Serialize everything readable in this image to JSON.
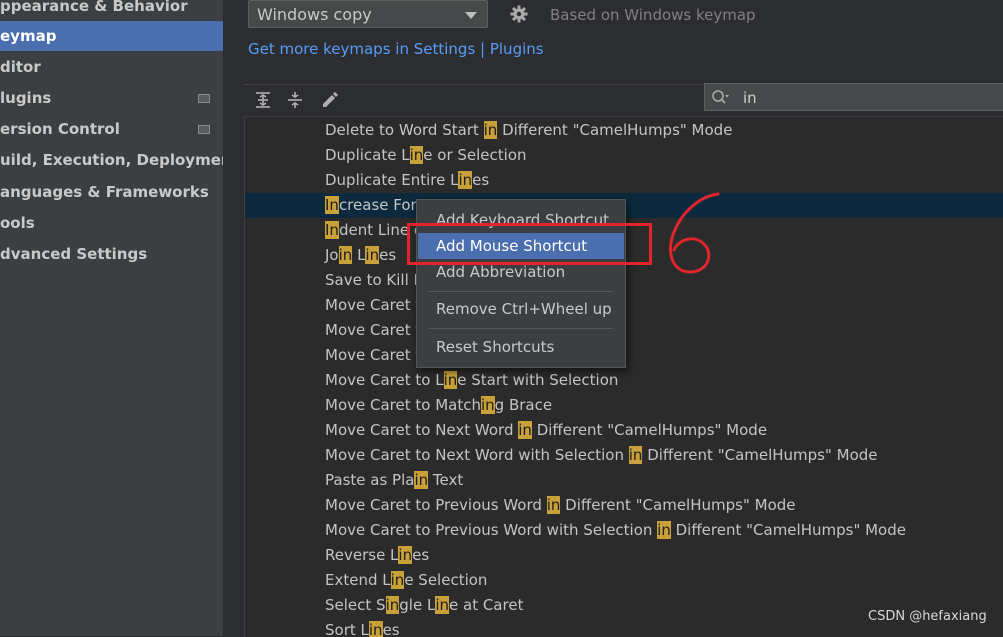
{
  "sidebar": {
    "items": [
      {
        "label": "ppearance & Behavior"
      },
      {
        "label": "eymap"
      },
      {
        "label": "ditor"
      },
      {
        "label": "lugins"
      },
      {
        "label": "ersion Control"
      },
      {
        "label": "uild, Execution, Deployment"
      },
      {
        "label": "anguages & Frameworks"
      },
      {
        "label": "ools"
      },
      {
        "label": "dvanced Settings"
      }
    ]
  },
  "header": {
    "keymap_selected": "Windows copy",
    "based_on": "Based on Windows keymap",
    "more_keymaps_link": "Get more keymaps in Settings | Plugins"
  },
  "search": {
    "value": "in"
  },
  "actions": [
    {
      "pre": "Delete to Word Start ",
      "hl": "in",
      "post": " Different \"CamelHumps\" Mode"
    },
    {
      "pre": "Duplicate L",
      "hl": "in",
      "post": "e or Selection"
    },
    {
      "pre": "Duplicate Entire L",
      "hl": "in",
      "post": "es"
    },
    {
      "pre": "",
      "hl": "In",
      "post": "crease Font"
    },
    {
      "pre": "",
      "hl": "In",
      "post": "dent Line o"
    },
    {
      "pre": "Jo",
      "hl": "in",
      "post": " L",
      "hl2": "in",
      "post2": "es"
    },
    {
      "pre": "Save to Kill R",
      "hl": "",
      "post": ""
    },
    {
      "pre": "Move Caret t",
      "hl": "",
      "post": ""
    },
    {
      "pre": "Move Caret t",
      "hl": "",
      "post": ""
    },
    {
      "pre": "Move Caret t",
      "hl": "",
      "post": ""
    },
    {
      "pre": "Move Caret to L",
      "hl": "in",
      "post": "e Start with Selection"
    },
    {
      "pre": "Move Caret to Match",
      "hl": "in",
      "post": "g Brace"
    },
    {
      "pre": "Move Caret to Next Word ",
      "hl": "in",
      "post": " Different \"CamelHumps\" Mode"
    },
    {
      "pre": "Move Caret to Next Word with Selection ",
      "hl": "in",
      "post": " Different \"CamelHumps\" Mode"
    },
    {
      "pre": "Paste as Pla",
      "hl": "in",
      "post": " Text"
    },
    {
      "pre": "Move Caret to Previous Word ",
      "hl": "in",
      "post": " Different \"CamelHumps\" Mode"
    },
    {
      "pre": "Move Caret to Previous Word with Selection ",
      "hl": "in",
      "post": " Different \"CamelHumps\" Mode"
    },
    {
      "pre": "Reverse L",
      "hl": "in",
      "post": "es"
    },
    {
      "pre": "Extend L",
      "hl": "in",
      "post": "e Selection"
    },
    {
      "pre": "Select S",
      "hl": "in",
      "post": "gle L",
      "hl2": "in",
      "post2": "e at Caret"
    },
    {
      "pre": "Sort L",
      "hl": "in",
      "post": "es"
    }
  ],
  "context_menu": {
    "items": [
      "Add Keyboard Shortcut",
      "Add Mouse Shortcut",
      "Add Abbreviation",
      "Remove Ctrl+Wheel up",
      "Reset Shortcuts"
    ]
  },
  "annotation": {
    "label": "6"
  },
  "watermark": "CSDN @hefaxiang",
  "colors": {
    "accent": "#4b6eaf",
    "link": "#589df6",
    "highlight": "#c9a13a",
    "annotation": "#e0262c"
  }
}
